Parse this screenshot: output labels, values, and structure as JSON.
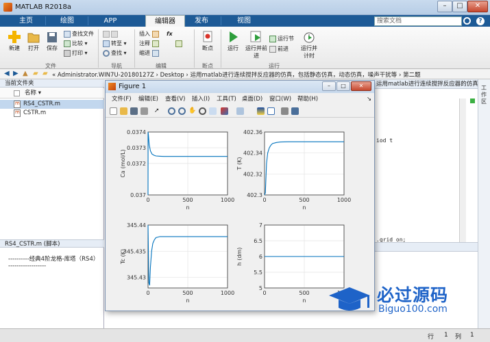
{
  "window": {
    "title": "MATLAB R2018a"
  },
  "ribbon_tabs": [
    {
      "label": "主页"
    },
    {
      "label": "绘图"
    },
    {
      "label": "APP"
    },
    {
      "label": "编辑器"
    },
    {
      "label": "发布"
    },
    {
      "label": "视图"
    }
  ],
  "search": {
    "placeholder": "搜索文档"
  },
  "ribbon": {
    "file": {
      "new": "新建",
      "open": "打开",
      "save": "保存",
      "find_files": "查找文件",
      "compare": "比较",
      "print": "打印",
      "group": "文件"
    },
    "nav": {
      "goto": "转至",
      "find": "查找",
      "group": "导航"
    },
    "edit": {
      "insert": "插入",
      "comment": "注释",
      "indent": "缩进",
      "fx": "fx",
      "group": "编辑"
    },
    "breakpoints": {
      "label": "断点",
      "group": "断点"
    },
    "run": {
      "run": "运行",
      "run_advance": "运行并前进",
      "run_section": "运行节",
      "advance": "前进",
      "run_time": "运行并计时",
      "group": "运行"
    }
  },
  "address": {
    "path": "« Administrator.WIN7U-20180127Z › Desktop › 运用matlab进行连续搅拌反应器的仿真，包括静态仿真，动态仿真，噪声干扰等 › 第二题"
  },
  "current_folder": {
    "title": "当前文件夹",
    "column": "名称 ▾",
    "files": [
      {
        "name": "RS4_CSTR.m",
        "selected": true
      },
      {
        "name": "CSTR.m",
        "selected": false
      }
    ],
    "detail_title": "RS4_CSTR.m  (脚本)",
    "detail_lines": [
      "----------经典4阶龙格-库塔（RS4）",
      "------------------"
    ]
  },
  "editor": {
    "tab_title": "运用matlab进行连续搅拌反应器的仿真，包括静态仿真，动态仿...",
    "code_fragments": [
      "iod t",
      ".grid on;"
    ]
  },
  "right_strip": {
    "labels": [
      "工作区"
    ]
  },
  "status": {
    "row_label": "行",
    "row": "1",
    "col_label": "列",
    "col": "1"
  },
  "figure": {
    "title": "Figure 1",
    "menu": [
      "文件(F)",
      "编辑(E)",
      "查看(V)",
      "插入(I)",
      "工具(T)",
      "桌面(D)",
      "窗口(W)",
      "帮助(H)"
    ],
    "toolbar_icons": [
      "new-figure-icon",
      "open-icon",
      "save-icon",
      "print-icon",
      "pointer-icon",
      "zoom-in-icon",
      "zoom-out-icon",
      "pan-icon",
      "rotate-icon",
      "datatip-icon",
      "brush-icon",
      "link-icon",
      "colorbar-icon",
      "legend-icon",
      "hide-plot-tools-icon",
      "show-plot-tools-icon"
    ]
  },
  "watermark": {
    "brand": "必过源码",
    "url": "Biguo100.com"
  },
  "colors": {
    "line": "#0072bd",
    "ribbon_blue": "#1d5a96"
  },
  "chart_data": [
    {
      "type": "line",
      "xlabel": "n",
      "ylabel": "Ca (mol/L)",
      "xlim": [
        0,
        1000
      ],
      "ylim": [
        0.037,
        0.0374
      ],
      "xticks": [
        "0",
        "500",
        "1000"
      ],
      "yticks": [
        "0.037",
        "0.0372",
        "0.0373",
        "0.0374"
      ],
      "ytick_values": [
        0.037,
        0.0372,
        0.0373,
        0.0374
      ],
      "grid": true,
      "x": [
        0,
        1,
        5,
        15,
        30,
        50,
        75,
        100,
        150,
        200,
        300,
        500,
        700,
        1000
      ],
      "y": [
        0.037,
        0.03745,
        0.03738,
        0.03732,
        0.03728,
        0.03726,
        0.037252,
        0.037248,
        0.037246,
        0.037245,
        0.037245,
        0.037245,
        0.037245,
        0.037245
      ]
    },
    {
      "type": "line",
      "xlabel": "n",
      "ylabel": "T (K)",
      "xlim": [
        0,
        1000
      ],
      "ylim": [
        402.3,
        402.36
      ],
      "xticks": [
        "0",
        "500",
        "1000"
      ],
      "yticks": [
        "402.3",
        "402.32",
        "402.34",
        "402.36"
      ],
      "ytick_values": [
        402.3,
        402.32,
        402.34,
        402.36
      ],
      "grid": true,
      "x": [
        0,
        10,
        25,
        40,
        60,
        80,
        100,
        150,
        200,
        300,
        500,
        700,
        1000
      ],
      "y": [
        402.3,
        402.302,
        402.33,
        402.34,
        402.345,
        402.3475,
        402.349,
        402.35,
        402.3505,
        402.3507,
        402.3507,
        402.3507,
        402.3507
      ]
    },
    {
      "type": "line",
      "xlabel": "n",
      "ylabel": "Tc (K)",
      "xlim": [
        0,
        1000
      ],
      "ylim": [
        345.428,
        345.44
      ],
      "xticks": [
        "0",
        "500",
        "1000"
      ],
      "yticks": [
        "345.43",
        "345.435",
        "345.44"
      ],
      "ytick_values": [
        345.43,
        345.435,
        345.44
      ],
      "grid": true,
      "x": [
        0,
        10,
        20,
        30,
        45,
        60,
        80,
        100,
        150,
        200,
        300,
        500,
        700,
        1000
      ],
      "y": [
        345.44,
        345.429,
        345.4285,
        345.432,
        345.435,
        345.4365,
        345.4372,
        345.4376,
        345.4378,
        345.4378,
        345.4378,
        345.4378,
        345.4378,
        345.4378
      ]
    },
    {
      "type": "line",
      "xlabel": "n",
      "ylabel": "h (dm)",
      "xlim": [
        0,
        1000
      ],
      "ylim": [
        5,
        7
      ],
      "xticks": [
        "0",
        "500",
        "1000"
      ],
      "yticks": [
        "5",
        "5.5",
        "6",
        "6.5",
        "7"
      ],
      "ytick_values": [
        5,
        5.5,
        6,
        6.5,
        7
      ],
      "grid": true,
      "x": [
        0,
        1000
      ],
      "y": [
        6,
        6
      ]
    }
  ]
}
